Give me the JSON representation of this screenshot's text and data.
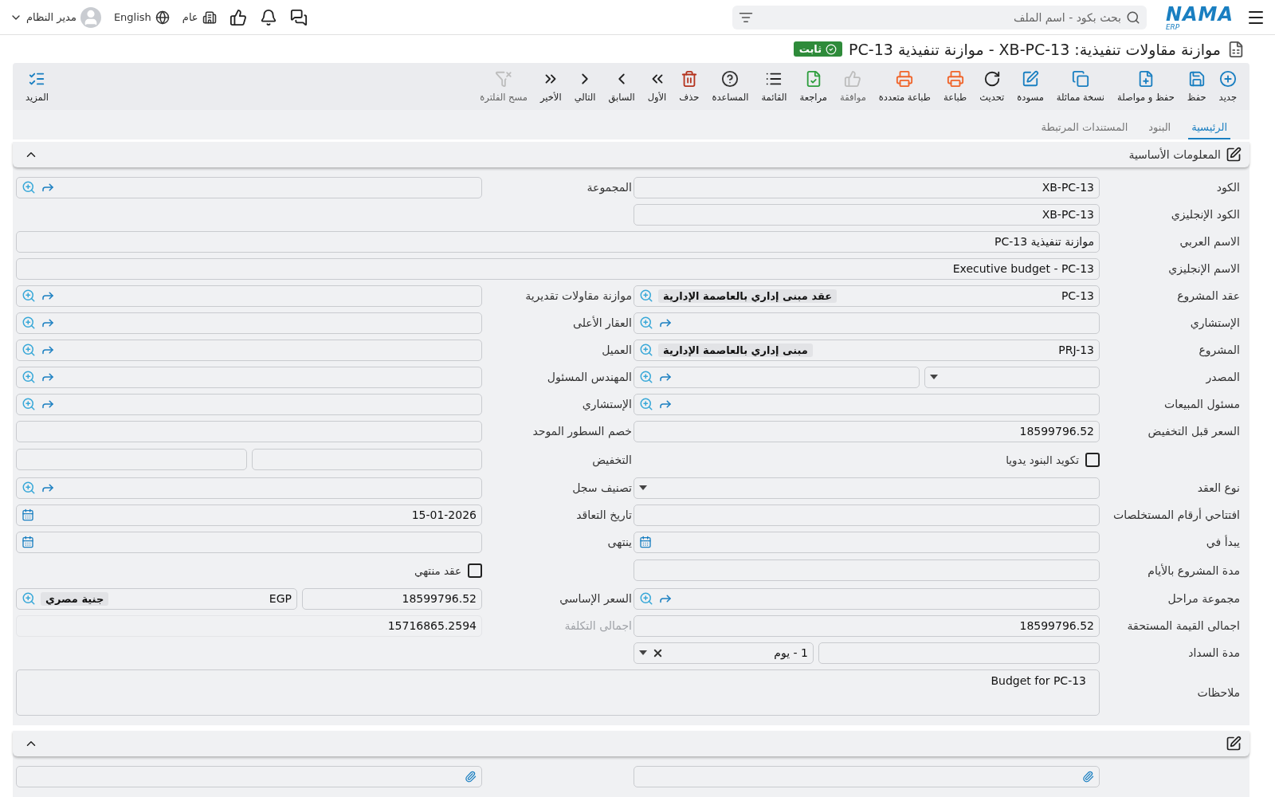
{
  "top_bar": {
    "logo": {
      "name": "NAMA",
      "suffix": "ERP"
    },
    "search": {
      "placeholder": "بحث بكود - اسم الملف"
    },
    "branch": "عام",
    "language": "English",
    "user": "مدير النظام"
  },
  "page": {
    "title": "موازنة مقاولات تنفيذية: XB-PC-13 - موازنة تنفيذية PC-13",
    "status": "ثابت"
  },
  "toolbar": {
    "actions": [
      {
        "label": "جديد",
        "color": "#1a7fc1",
        "disabled": false
      },
      {
        "label": "حفظ",
        "color": "#1a7fc1",
        "disabled": false
      },
      {
        "label": "حفظ و مواصلة",
        "color": "#1a7fc1",
        "disabled": false
      },
      {
        "label": "نسخة مماثلة",
        "color": "#1a7fc1",
        "disabled": false
      },
      {
        "label": "مسودة",
        "color": "#1a7fc1",
        "disabled": false
      },
      {
        "label": "تحديث",
        "color": "#222222",
        "disabled": false
      },
      {
        "label": "طباعة",
        "color": "#f0642a",
        "disabled": false
      },
      {
        "label": "طباعة متعددة",
        "color": "#f0642a",
        "disabled": false
      },
      {
        "label": "موافقة",
        "color": "#bdbdbd",
        "disabled": true
      },
      {
        "label": "مراجعة",
        "color": "#2e9e3e",
        "disabled": false
      },
      {
        "label": "القائمة",
        "color": "#222222",
        "disabled": false
      },
      {
        "label": "المساعدة",
        "color": "#333333",
        "disabled": false
      },
      {
        "label": "حذف",
        "color": "#b5341f",
        "disabled": false
      },
      {
        "label": "الأول",
        "color": "#222222",
        "disabled": false
      },
      {
        "label": "السابق",
        "color": "#222222",
        "disabled": false
      },
      {
        "label": "التالي",
        "color": "#222222",
        "disabled": false
      },
      {
        "label": "الأخير",
        "color": "#222222",
        "disabled": false
      },
      {
        "label": "مسح الفلترة",
        "color": "#bdbdbd",
        "disabled": true
      }
    ],
    "more": {
      "label": "المزيد"
    }
  },
  "tabs": [
    {
      "label": "الرئيسية",
      "selected": true
    },
    {
      "label": "البنود",
      "selected": false
    },
    {
      "label": "المستندات المرتبطة",
      "selected": false
    }
  ],
  "sections": [
    {
      "title": "المعلومات الأساسية",
      "expanded": true,
      "rows": [
        {
          "right": {
            "label": "الكود",
            "kind": "text",
            "value": "XB-PC-13",
            "disabled": false
          },
          "left": {
            "label": "المجموعة",
            "kind": "lookup",
            "link": true
          }
        },
        {
          "right": {
            "label": "الكود الإنجليزي",
            "kind": "text",
            "value": "XB-PC-13",
            "disabled": false
          }
        },
        {
          "full": {
            "label": "الاسم العربي",
            "kind": "text",
            "value": "موازنة تنفيذية PC-13",
            "disabled": false
          }
        },
        {
          "full": {
            "label": "الاسم الإنجليزي",
            "kind": "text",
            "value": "Executive budget - PC-13",
            "disabled": false
          }
        },
        {
          "right": {
            "label": "عقد المشروع",
            "kind": "lookup",
            "value": "PC-13",
            "chip": "عقد مبنى إداري بالعاصمة الإدارية",
            "link": false
          },
          "left": {
            "label": "موازنة مقاولات تقديرية",
            "kind": "lookup",
            "link": true
          }
        },
        {
          "right": {
            "label": "الإستشاري",
            "kind": "lookup",
            "link": true
          },
          "left": {
            "label": "العقار الأعلى",
            "kind": "lookup",
            "link": true
          }
        },
        {
          "right": {
            "label": "المشروع",
            "kind": "lookup",
            "value": "PRJ-13",
            "chip": "مبنى إداري بالعاصمة الإدارية",
            "link": false
          },
          "left": {
            "label": "العميل",
            "kind": "lookup",
            "link": true
          }
        },
        {
          "right": {
            "label": "المصدر",
            "kind": "source"
          },
          "left": {
            "label": "المهندس المسئول",
            "kind": "lookup",
            "link": true
          }
        },
        {
          "right": {
            "label": "مسئول المبيعات",
            "kind": "lookup",
            "link": true
          },
          "left": {
            "label": "الإستشاري",
            "kind": "lookup",
            "link": true
          }
        },
        {
          "right": {
            "label": "السعر قبل التخفيض",
            "kind": "text",
            "value": "18599796.52",
            "disabled": false
          },
          "left": {
            "label": "خصم السطور الموحد",
            "kind": "text",
            "disabled": false
          }
        },
        {
          "right": {
            "kind": "checkbox",
            "label": "تكويد البنود يدويا",
            "checked": false
          },
          "left": {
            "label": "التخفيض",
            "kind": "pair"
          }
        },
        {
          "right": {
            "label": "نوع العقد",
            "kind": "dropdown"
          },
          "left": {
            "label": "تصنيف سجل",
            "kind": "lookup",
            "link": true
          }
        },
        {
          "right": {
            "label": "افتتاحي أرقام المستخلصات",
            "kind": "text",
            "disabled": false
          },
          "left": {
            "label": "تاريخ التعاقد",
            "kind": "date",
            "value": "15-01-2026"
          }
        },
        {
          "right": {
            "label": "يبدأ في",
            "kind": "date"
          },
          "left": {
            "label": "ينتهى",
            "kind": "date"
          }
        },
        {
          "right": {
            "label": "مدة المشروع بالأيام",
            "kind": "text",
            "disabled": false
          },
          "left": {
            "kind": "checkbox",
            "label": "عقد منتهي",
            "checked": false
          }
        },
        {
          "right": {
            "label": "مجموعة مراحل",
            "kind": "lookup",
            "link": true
          },
          "left": {
            "label": "السعر الإساسي",
            "kind": "money",
            "value": "18599796.52",
            "currency": "EGP",
            "currency_name": "جنية مصري"
          }
        },
        {
          "right": {
            "label": "اجمالى القيمة المستحقة",
            "kind": "text",
            "value": "18599796.52",
            "disabled": false
          },
          "left": {
            "label": "اجمالى التكلفة",
            "kind": "text",
            "value": "15716865.2594",
            "disabled": true
          }
        },
        {
          "right": {
            "label": "مدة السداد",
            "kind": "term",
            "option": "1 - يوم"
          }
        },
        {
          "full": {
            "label": "ملاحظات",
            "kind": "textarea",
            "value": "Budget for PC-13"
          }
        }
      ]
    },
    {
      "expanded": true,
      "rows": [
        {
          "right": {
            "kind": "attachment"
          },
          "left": {
            "kind": "attachment"
          }
        }
      ]
    }
  ]
}
